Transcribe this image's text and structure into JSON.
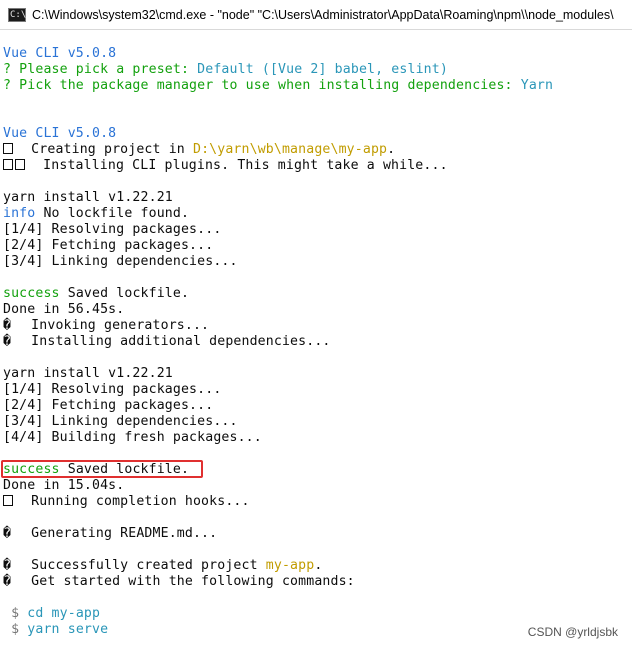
{
  "window": {
    "icon_text": "C:\\",
    "title": "C:\\Windows\\system32\\cmd.exe  - \"node\"   \"C:\\Users\\Administrator\\AppData\\Roaming\\npm\\\\node_modules\\"
  },
  "console": {
    "vue_cli_1": "Vue CLI v5.0.8",
    "preset_prompt": "? Please pick a preset: ",
    "preset_value": "Default ([Vue 2] babel, eslint)",
    "pm_prompt": "? Pick the package manager to use when installing dependencies: ",
    "pm_value": "Yarn",
    "vue_cli_2": "Vue CLI v5.0.8",
    "creating_prefix": "  Creating project in ",
    "creating_path": "D:\\yarn\\wb\\manage\\my-app",
    "creating_suffix": ".",
    "installing_plugins": "  Installing CLI plugins. This might take a while...",
    "yarn_install_1": "yarn install v1.22.21",
    "info_tag": "info",
    "no_lockfile": " No lockfile found.",
    "step1": "[1/4] Resolving packages...",
    "step2": "[2/4] Fetching packages...",
    "step3": "[3/4] Linking dependencies...",
    "success_tag_1": "success",
    "saved_lockfile_1": " Saved lockfile.",
    "done_1": "Done in 56.45s.",
    "glyph": "�",
    "invoking_generators": "  Invoking generators...",
    "installing_additional": "  Installing additional dependencies...",
    "yarn_install_2": "yarn install v1.22.21",
    "step1b": "[1/4] Resolving packages...",
    "step2b": "[2/4] Fetching packages...",
    "step3b": "[3/4] Linking dependencies...",
    "step4b": "[4/4] Building fresh packages...",
    "success_tag_2": "success",
    "saved_lockfile_2": " Saved lockfile.",
    "done_2": "Done in 15.04s.",
    "running_hooks": "  Running completion hooks...",
    "generating_readme": "  Generating README.md...",
    "created_prefix": "  Successfully created project ",
    "created_name": "my-app",
    "created_suffix": ".",
    "get_started": "  Get started with the following commands:",
    "cmd1_prompt": " $ ",
    "cmd1": "cd my-app",
    "cmd2_prompt": " $ ",
    "cmd2": "yarn serve"
  },
  "watermark": "CSDN @yrldjsbk",
  "colors": {
    "info_blue": "#2a73d6",
    "success_green": "#13a10e",
    "highlight_red": "#e03030",
    "path_yellow": "#c19c00"
  }
}
